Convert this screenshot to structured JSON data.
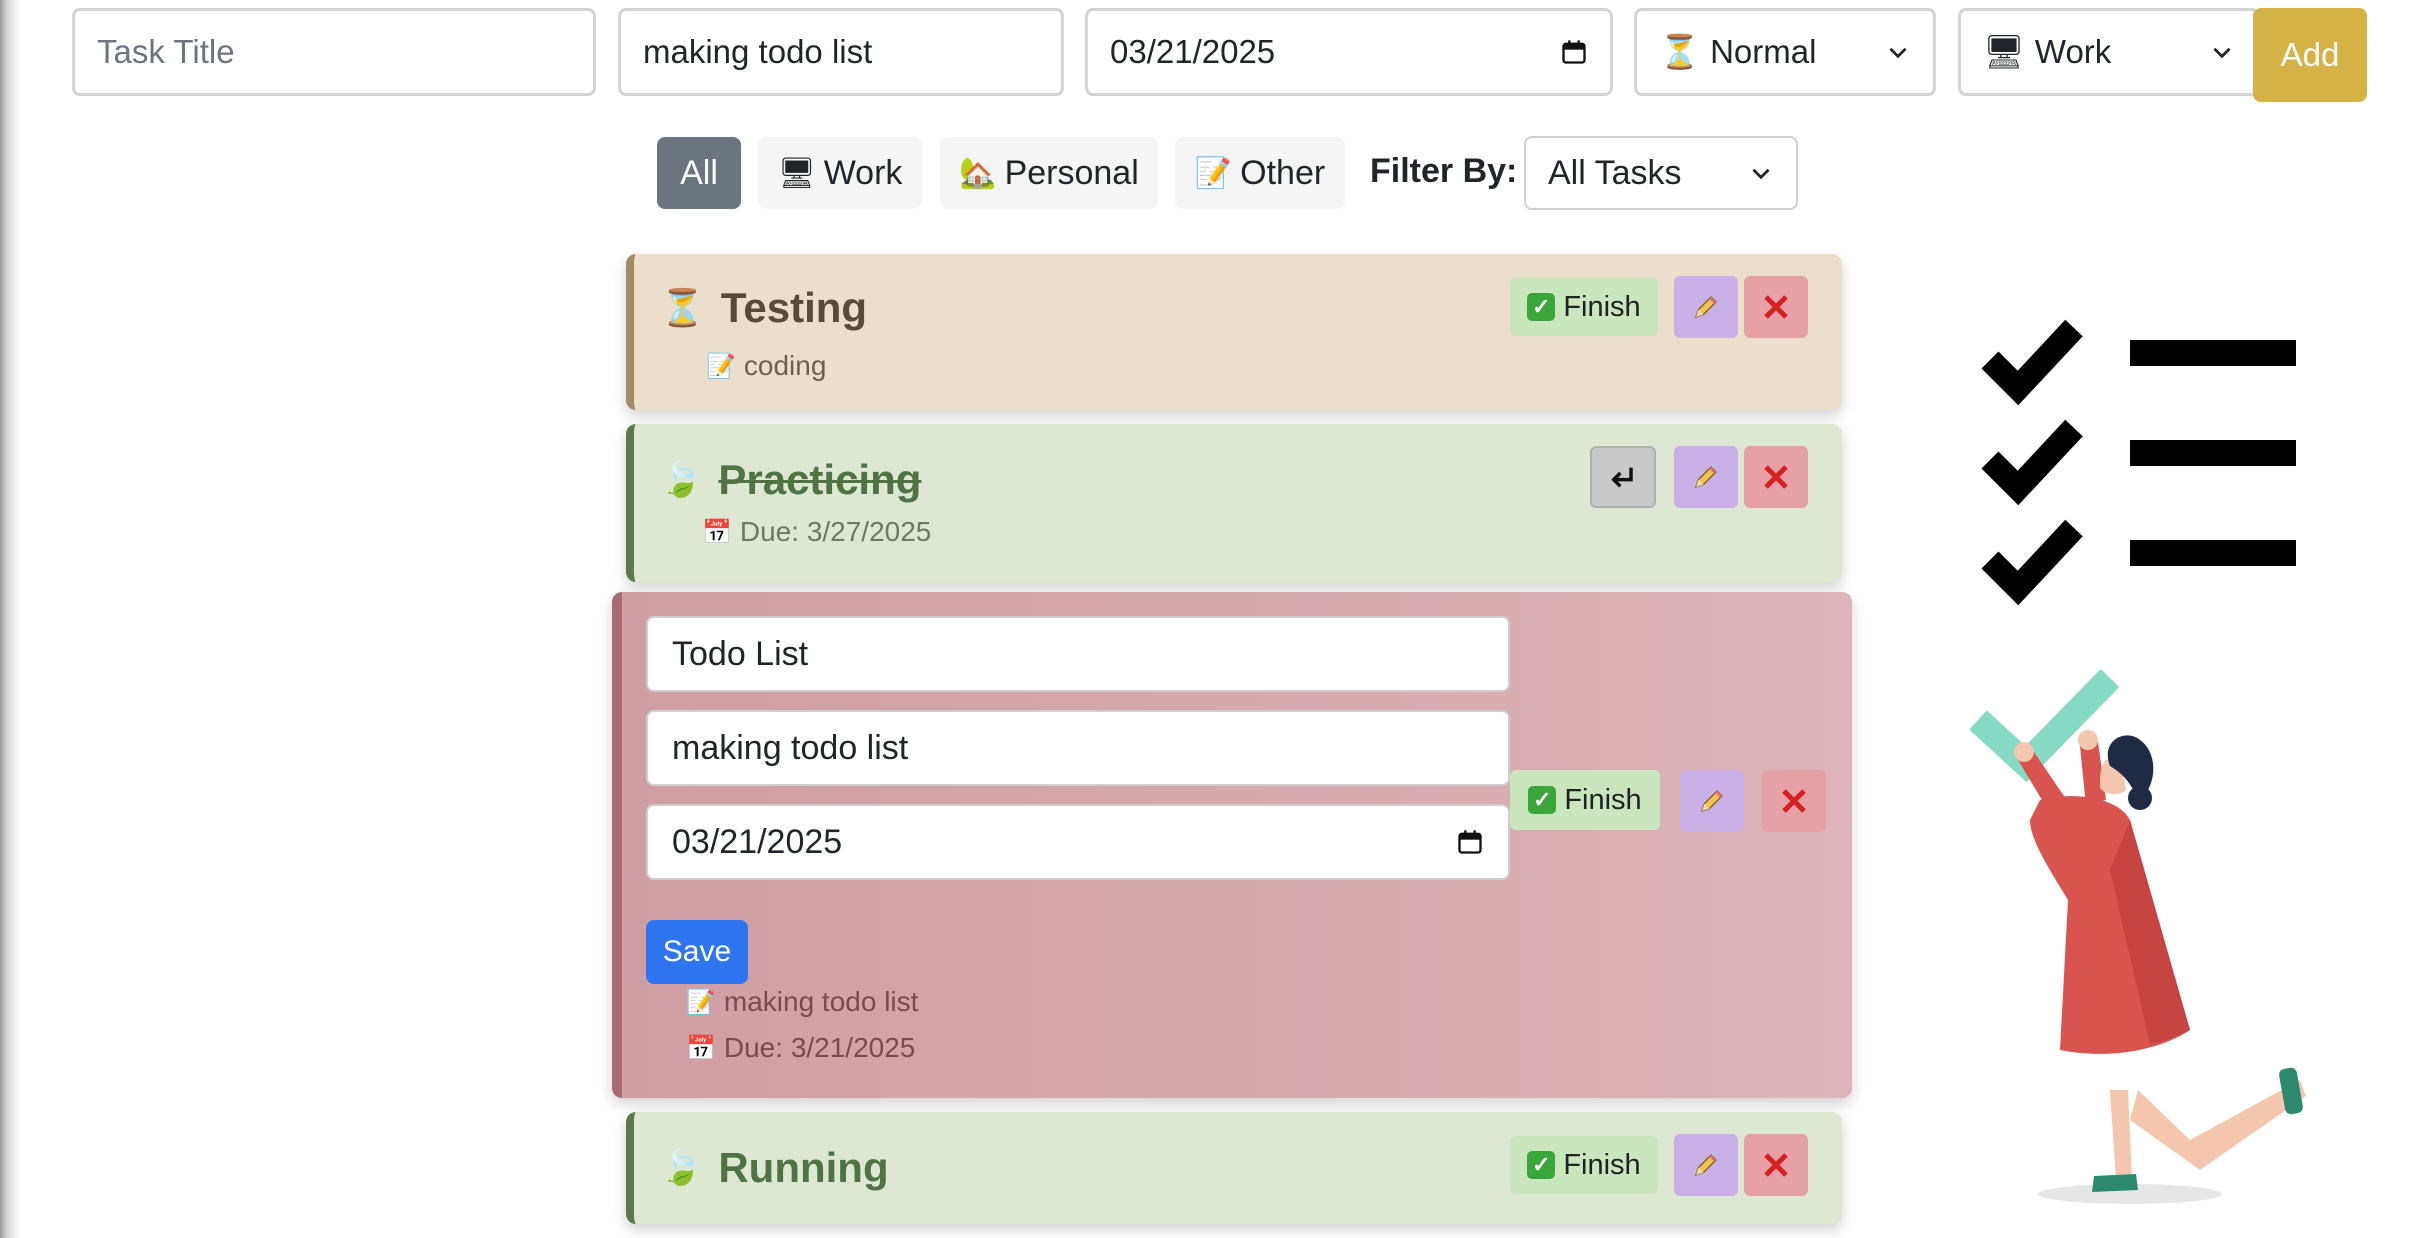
{
  "form": {
    "title_placeholder": "Task Title",
    "description_value": "making todo list",
    "date_value": "03/21/2025",
    "priority_icon": "hourglass-icon",
    "priority_value": "Normal",
    "category_icon": "computer-icon",
    "category_value": "Work",
    "add_label": "Add"
  },
  "filters": {
    "categories": [
      {
        "label": "All",
        "icon": "",
        "active": true
      },
      {
        "label": "Work",
        "icon": "computer-icon",
        "active": false
      },
      {
        "label": "Personal",
        "icon": "house-icon",
        "active": false
      },
      {
        "label": "Other",
        "icon": "memo-icon",
        "active": false
      }
    ],
    "filter_by_label": "Filter By:",
    "filter_by_value": "All Tasks"
  },
  "tasks": [
    {
      "title": "Testing",
      "status_icon": "hourglass-icon",
      "description": "coding",
      "finish_label": "Finish",
      "state": "pending"
    },
    {
      "title": "Practicing",
      "status_icon": "leaf-icon",
      "due": "Due: 3/27/2025",
      "state": "completed"
    },
    {
      "state": "editing",
      "edit_title_value": "Todo List",
      "edit_description_value": "making todo list",
      "edit_date_value": "03/21/2025",
      "save_label": "Save",
      "description": "making todo list",
      "due": "Due: 3/21/2025",
      "finish_label": "Finish"
    },
    {
      "title": "Running",
      "status_icon": "leaf-icon",
      "finish_label": "Finish",
      "state": "pending-low"
    }
  ],
  "colors": {
    "add_button": "#d4b245",
    "save_button": "#2f74f0",
    "active_filter": "#6c757d",
    "finish_button": "#c9e6bd",
    "edit_button": "#c9b1e8",
    "delete_button": "#e6a1a6"
  }
}
